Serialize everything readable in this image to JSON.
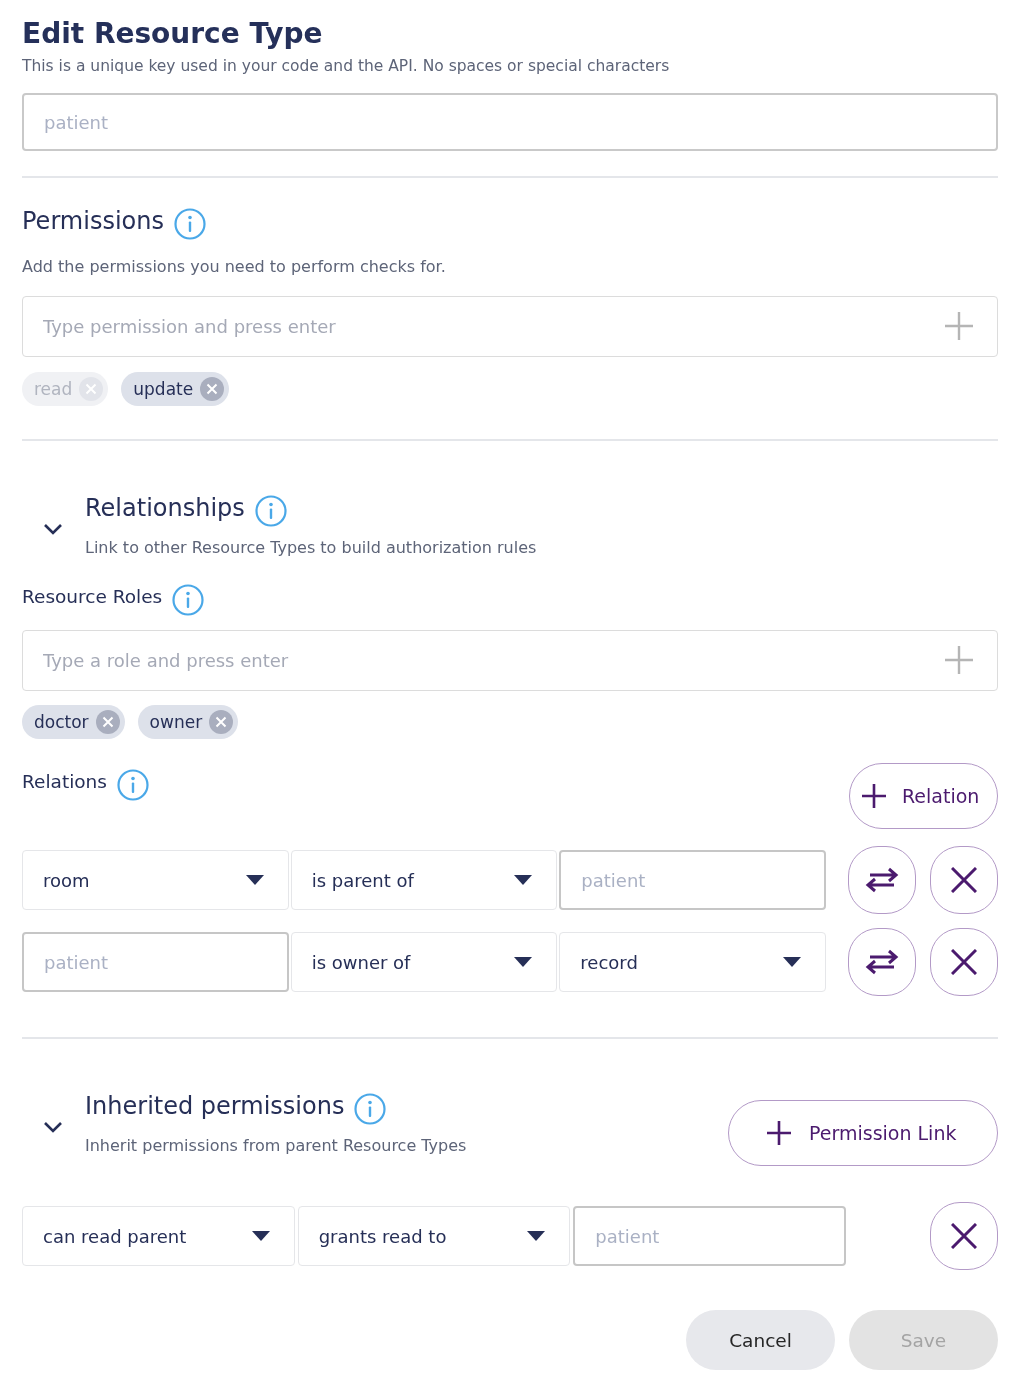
{
  "title": "Edit Resource Type",
  "key_field": {
    "hint": "This is a unique key used in your code and the API. No spaces or special characters",
    "value": "patient",
    "disabled": true
  },
  "permissions": {
    "heading": "Permissions",
    "description": "Add the permissions you need to perform checks for.",
    "input": {
      "placeholder": "Type permission and press enter"
    },
    "tags": [
      {
        "label": "read",
        "disabled": true
      },
      {
        "label": "update",
        "disabled": false
      }
    ]
  },
  "relationships": {
    "heading": "Relationships",
    "description": "Link to other Resource Types to build authorization rules",
    "expanded": true,
    "resource_roles": {
      "label": "Resource Roles",
      "input": {
        "placeholder": "Type a role and press enter"
      },
      "tags": [
        {
          "label": "doctor",
          "disabled": false
        },
        {
          "label": "owner",
          "disabled": false
        }
      ]
    },
    "relations": {
      "label": "Relations",
      "add_button": "Relation",
      "rows": [
        {
          "cells": [
            {
              "kind": "select",
              "value": "room"
            },
            {
              "kind": "select",
              "value": "is parent of"
            },
            {
              "kind": "input",
              "value": "patient",
              "disabled": true
            }
          ]
        },
        {
          "cells": [
            {
              "kind": "input",
              "value": "patient",
              "disabled": true
            },
            {
              "kind": "select",
              "value": "is owner of"
            },
            {
              "kind": "select",
              "value": "record"
            }
          ]
        }
      ]
    }
  },
  "inherited_permissions": {
    "heading": "Inherited permissions",
    "description": "Inherit permissions from parent Resource Types",
    "expanded": true,
    "add_button": "Permission Link",
    "rows": [
      {
        "cells": [
          {
            "kind": "select",
            "value": "can read parent"
          },
          {
            "kind": "select",
            "value": "grants read to"
          },
          {
            "kind": "input",
            "value": "patient",
            "disabled": true
          }
        ]
      }
    ]
  },
  "footer": {
    "buttons": [
      {
        "label": "Cancel",
        "kind": "secondary",
        "disabled": false
      },
      {
        "label": "Save",
        "kind": "primary",
        "disabled": true
      }
    ]
  }
}
